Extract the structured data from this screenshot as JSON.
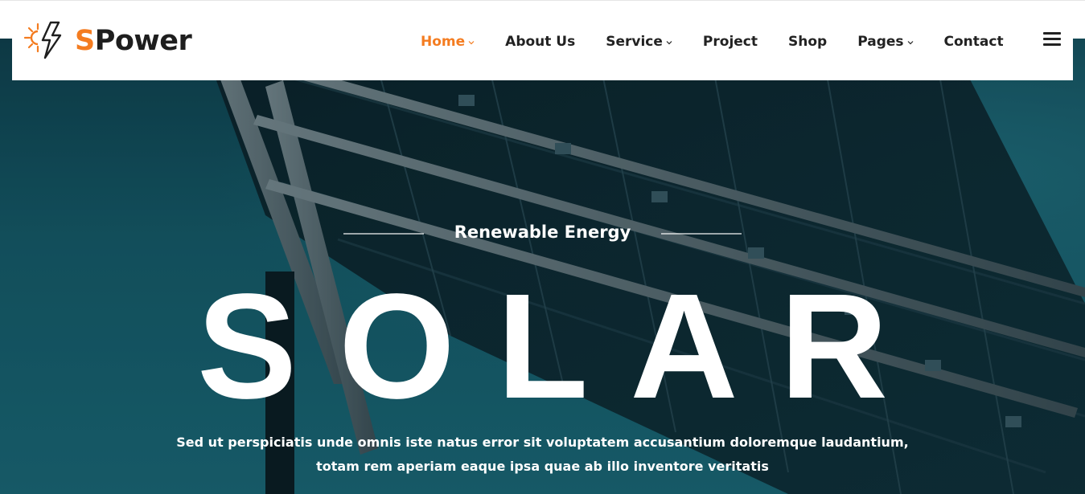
{
  "brand": {
    "initial": "S",
    "rest": "Power",
    "accent_color": "#f47c20",
    "logo_icon": "sun-lightning-icon"
  },
  "nav": {
    "items": [
      {
        "label": "Home",
        "dropdown": true,
        "active": true
      },
      {
        "label": "About Us",
        "dropdown": false,
        "active": false
      },
      {
        "label": "Service",
        "dropdown": true,
        "active": false
      },
      {
        "label": "Project",
        "dropdown": false,
        "active": false
      },
      {
        "label": "Shop",
        "dropdown": false,
        "active": false
      },
      {
        "label": "Pages",
        "dropdown": true,
        "active": false
      },
      {
        "label": "Contact",
        "dropdown": false,
        "active": false
      }
    ],
    "menu_icon": "hamburger-menu-icon"
  },
  "hero": {
    "eyebrow": "Renewable Energy",
    "title": "SOLAR",
    "description": "Sed ut perspiciatis unde omnis iste natus error sit voluptatem accusantium doloremque laudantium, totam rem aperiam eaque ipsa quae ab illo inventore veritatis",
    "background_color": "#155a68"
  }
}
